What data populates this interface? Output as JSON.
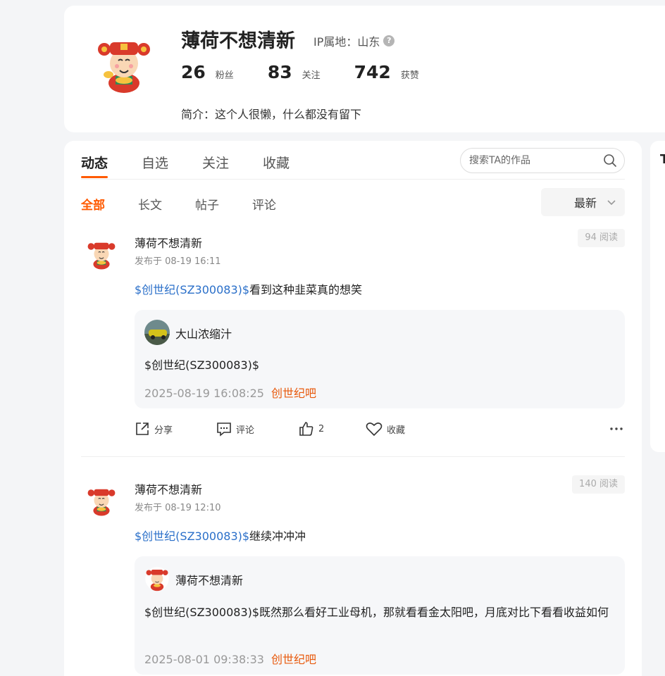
{
  "profile": {
    "username": "薄荷不想清新",
    "ip_location": "IP属地：山东",
    "stats": [
      {
        "num": "26",
        "label": "粉丝"
      },
      {
        "num": "83",
        "label": "关注"
      },
      {
        "num": "742",
        "label": "获赞"
      }
    ],
    "bio": "简介：这个人很懒，什么都没有留下"
  },
  "tabs": [
    "动态",
    "自选",
    "关注",
    "收藏"
  ],
  "search": {
    "placeholder": "搜索TA的作品"
  },
  "subtabs": [
    "全部",
    "长文",
    "帖子",
    "评论"
  ],
  "sort": {
    "label": "最新"
  },
  "side_panel": {
    "title": "T"
  },
  "posts": [
    {
      "author": "薄荷不想清新",
      "time": "发布于 08-19 16:11",
      "reads": "94 阅读",
      "stock": "$创世纪(SZ300083)$",
      "text": "看到这种韭菜真的想笑",
      "quote": {
        "author": "大山浓缩汁",
        "text": "$创世纪(SZ300083)$",
        "time": "2025-08-19 16:08:25",
        "bar": "创世纪吧"
      },
      "actions": {
        "share": "分享",
        "comment": "评论",
        "likes": "2",
        "favorite": "收藏"
      }
    },
    {
      "author": "薄荷不想清新",
      "time": "发布于 08-19 12:10",
      "reads": "140 阅读",
      "stock": "$创世纪(SZ300083)$",
      "text": "继续冲冲冲",
      "quote": {
        "author": "薄荷不想清新",
        "text": "$创世纪(SZ300083)$既然那么看好工业母机，那就看看金太阳吧，月底对比下看看收益如何",
        "time": "2025-08-01 09:38:33",
        "bar": "创世纪吧"
      }
    }
  ]
}
